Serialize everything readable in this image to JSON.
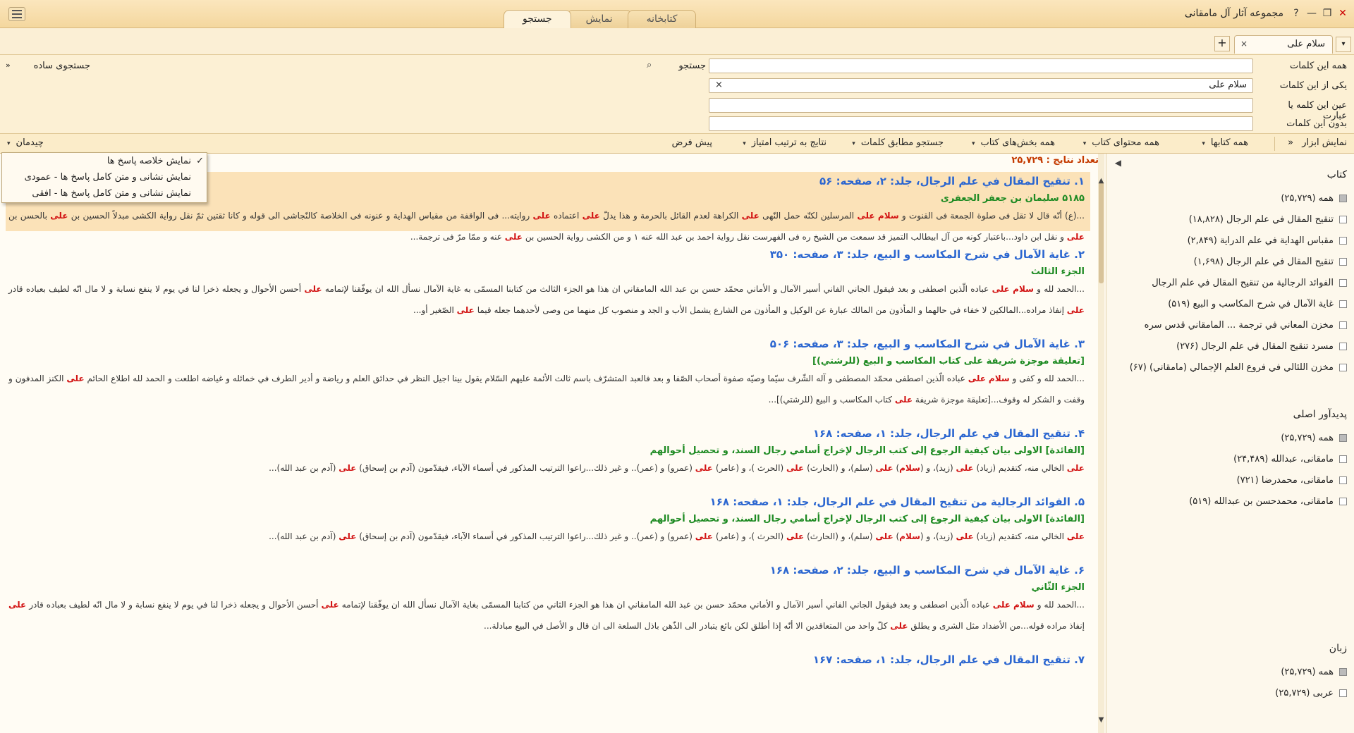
{
  "window": {
    "title": "مجموعه آثار آل مامقانی",
    "help_icon": "?",
    "min_icon": "—",
    "restore_icon": "❐",
    "close_icon": "✕"
  },
  "tabs": [
    {
      "label": "کتابخانه"
    },
    {
      "label": "نمایش"
    },
    {
      "label": "جستجو"
    }
  ],
  "doc_tab": {
    "label": "سلام علی",
    "close": "×",
    "add": "+",
    "dropdown": "▾"
  },
  "search": {
    "rows": [
      {
        "label": "همه این کلمات",
        "value": ""
      },
      {
        "label": "یکی از این کلمات",
        "value": "سلام علی",
        "clear": "×"
      },
      {
        "label": "عین این کلمه یا عبارت",
        "value": ""
      },
      {
        "label": "بدون این کلمات",
        "value": ""
      }
    ],
    "search_button": "جستجو",
    "search_icon": "⌕",
    "simple_search": "جستجوی ساده",
    "simple_search_icon": "«"
  },
  "toolbar": {
    "tools": "نمایش ابزار",
    "tools_icon": "«",
    "books": "همه کتابها",
    "content": "همه محتوای کتاب",
    "sections": "همه بخش‌های کتاب",
    "match": "جستجو مطابق کلمات",
    "order": "نتایج به ترتیب امتیاز",
    "default": "پیش فرض",
    "layout": "چیدمان",
    "dropdown_icon": "▾"
  },
  "layout_menu": [
    {
      "label": "نمایش خلاصه پاسخ ها",
      "checked": true
    },
    {
      "label": "نمایش نشانی و متن کامل پاسخ ها - عمودی",
      "checked": false
    },
    {
      "label": "نمایش نشانی و متن کامل پاسخ ها - افقی",
      "checked": false
    }
  ],
  "results": {
    "count_label": "تعداد نتایج :",
    "count_value": "۲۵,۷۲۹",
    "items": [
      {
        "title": "۱. تنقیح المقال في علم الرجال، جلد: ۲، صفحه: ۵۶",
        "subtitle": "۵۱۸۵ سلیمان بن جعفر الجعفری",
        "text": "...(ع) أنّه قال لا تقل فی صلوة الجمعة فی القنوت و سلام علی المرسلين لكنّه حمل النّهى على الكراهة لعدم القائل بالحرمة و هذا يدلّ على اعتماده على روايته... فی الواقفة من مقباس الهداية و عنونه فی الخلاصة كالنّجاشى الى قوله و كانا ثقتين ثمّ نقل رواية الكشى مبدلاً الحسين بن علی بالحسن بن علی و نقل ابن داود...باعتبار كونه من آل ابيطالب التميز قد سمعت من الشيخ ره فی الفهرست نقل رواية احمد بن عبد الله عنه ١ و من الكشى رواية الحسين بن علی عنه و ممّا مرّ فی ترجمة..."
      },
      {
        "title": "۲. غاية الآمال في شرح المكاسب و البيع، جلد: ۳، صفحه: ۳۵۰",
        "subtitle": "الجزء الثالث",
        "text": "...الحمد لله و سلام علی عباده الّذين اصطفى و بعد فيقول الجاني الفاني أسير الآمال و الأماني محمّد حسن بن عبد الله المامقاني ان هذا هو الجزء الثالث من كتابنا المسمّى به غاية الآمال نسأل الله ان يوفّقنا لإتمامه على أحسن الأحوال و يجعله ذخرا لنا في يوم لا ينفع نسابة و لا مال انّه لطيف بعباده قادر على إنفاذ مراده...المالكين لا خفاء في حالهما و المأذون من المالك عبارة عن الوكيل و المأذون من الشارع يشمل الأب و الجد و منصوب كل منهما من وصى لأحدهما جعله قيما على الصّغير أو..."
      },
      {
        "title": "۳. غاية الآمال في شرح المكاسب و البيع، جلد: ۳، صفحه: ۵۰۶",
        "subtitle": "[تعليقة موجزة شريفة على كتاب المكاسب و البيع (للرشتي)]",
        "text": "...الحمد لله و كفى و سلام علی عباده الّذين اصطفى محمّد المصطفى و آله الشّرف سيّما وصيّه صفوة أصحاب الصّفا و بعد فالعبد المتشرّف باسم ثالث الأئمة عليهم السّلام يقول بينا اجيل النظر في حدائق العلم و رياضة و أدير الطرف في خمائله و غياضه اطلعت و الحمد لله اطلاع الحائم على الكنز المدفون و وقفت و الشكر له وقوف...[تعليقة موجزة شريفة على كتاب المكاسب و البيع (للرشتي)]..."
      },
      {
        "title": "۴. تنقیح المقال في علم الرجال، جلد: ۱، صفحه: ۱۶۸",
        "subtitle": "[الفائدة] الاولى بيان كيفية الرجوع إلى كتب الرجال لإخراج أسامي رجال السند، و تحصيل أحوالهم",
        "text": "على الخالي منه، كتقديم (زياد) على (زيد)، و (سلام) على (سلم)، و (الحارث) على (الحرث )، و (عامر) على (عمرو) و (عمر).. و غير ذلك...راعوا الترتيب المذكور في أسماء الآباء، فيقدّمون (آدم بن إسحاق) على (آدم بن عبد الله)..."
      },
      {
        "title": "۵. الفوائد الرجالية من تنقيح المقال في علم الرجال، جلد: ۱، صفحه: ۱۶۸",
        "subtitle": "[الفائدة] الاولى بيان كيفية الرجوع إلى كتب الرجال لإخراج أسامي رجال السند، و تحصيل أحوالهم",
        "text": "على الخالي منه، كتقديم (زياد) على (زيد)، و (سلام) على (سلم)، و (الحارث) على (الحرث )، و (عامر) على (عمرو) و (عمر).. و غير ذلك...راعوا الترتيب المذكور في أسماء الآباء، فيقدّمون (آدم بن إسحاق) على (آدم بن عبد الله)..."
      },
      {
        "title": "۶. غاية الآمال في شرح المكاسب و البيع، جلد: ۲، صفحه: ۱۶۸",
        "subtitle": "الجزء الثّاني",
        "text": "...الحمد لله و سلام علی عباده الّذين اصطفى و بعد فيقول الجاني الفاني أسير الآمال و الأماني محمّد حسن بن عبد الله المامقاني ان هذا هو الجزء الثاني من كتابنا المسمّى بغاية الآمال نسأل الله ان يوفّقنا لإتمامه على أحسن الأحوال و يجعله ذخرا لنا في يوم لا ينفع نسابة و لا مال انّه لطيف بعباده قادر على إنفاذ مراده قوله...من الأضداد مثل الشرى و يطلق على كلّ واحد من المتعاقدين الا أنّه إذا أطلق لكن بائع يتبادر الى الذّهن باذل السلعة الى ان قال و الأصل في البيع مبادلة..."
      },
      {
        "title": "۷. تنقیح المقال في علم الرجال، جلد: ۱، صفحه: ۱۶۷",
        "subtitle": "",
        "text": ""
      }
    ]
  },
  "facets": {
    "arrow": "◀",
    "books_title": "کتاب",
    "books": [
      {
        "label": "همه (۲۵,۷۲۹)",
        "on": true
      },
      {
        "label": "تنقیح المقال في علم الرجال (۱۸,۸۲۸)",
        "on": false
      },
      {
        "label": "مقباس الهداية في علم الدراية (۲,۸۴۹)",
        "on": false
      },
      {
        "label": "تنقیح المقال في علم الرجال (۱,۶۹۸)",
        "on": false
      },
      {
        "label": "الفوائد الرجالية من تنقيح المقال في علم الرجال",
        "on": false
      },
      {
        "label": "غاية الآمال في شرح المكاسب و البيع (۵۱۹)",
        "on": false
      },
      {
        "label": "مخزن المعاني في ترجمة ... المامقاني قدس سره",
        "on": false
      },
      {
        "label": "مسرد تنقيح المقال في علم الرجال (۲۷۶)",
        "on": false
      },
      {
        "label": "مخزن اللئالي في فروع العلم الإجمالي (مامقاني) (۶۷)",
        "on": false
      }
    ],
    "authors_title": "پدیدآور اصلی",
    "authors": [
      {
        "label": "همه (۲۵,۷۲۹)",
        "on": true
      },
      {
        "label": "مامقانی، عبدالله (۲۴,۴۸۹)",
        "on": false
      },
      {
        "label": "مامقانی، محمدرضا (۷۲۱)",
        "on": false
      },
      {
        "label": "مامقانی، محمدحسن بن عبدالله (۵۱۹)",
        "on": false
      }
    ],
    "lang_title": "زبان",
    "langs": [
      {
        "label": "همه (۲۵,۷۲۹)",
        "on": true
      },
      {
        "label": "عربی (۲۵,۷۲۹)",
        "on": false
      }
    ]
  }
}
